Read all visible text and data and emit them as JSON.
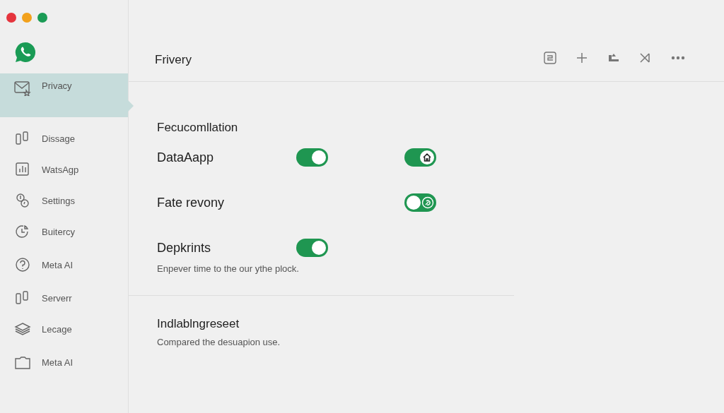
{
  "header": {
    "title": "Frivery"
  },
  "sidebar": {
    "items": [
      {
        "label": "Privacy",
        "selected": true
      },
      {
        "label": "Dissage",
        "selected": false
      },
      {
        "label": "WatsAgp",
        "selected": false
      },
      {
        "label": "Settings",
        "selected": false
      },
      {
        "label": "Buitercy",
        "selected": false
      },
      {
        "label": "Meta AI",
        "selected": false
      },
      {
        "label": "Serverr",
        "selected": false
      },
      {
        "label": "Lecage",
        "selected": false
      },
      {
        "label": "Meta AI",
        "selected": false
      }
    ]
  },
  "section": {
    "title": "Fecucomllation",
    "rows": [
      {
        "label": "DataAapp",
        "toggles": [
          {
            "on": true,
            "kind": "plain"
          },
          {
            "on": true,
            "kind": "home"
          }
        ]
      },
      {
        "label": "Fate revony",
        "toggles": [
          {
            "on": false,
            "kind": "refresh"
          }
        ]
      },
      {
        "label": "Depkrints",
        "description": "Enpever time to the our ythe plock.",
        "toggles": [
          {
            "on": true,
            "kind": "plain"
          }
        ]
      }
    ]
  },
  "section2": {
    "title": "Indlablngreseet",
    "description": "Compared the desuapion use."
  }
}
